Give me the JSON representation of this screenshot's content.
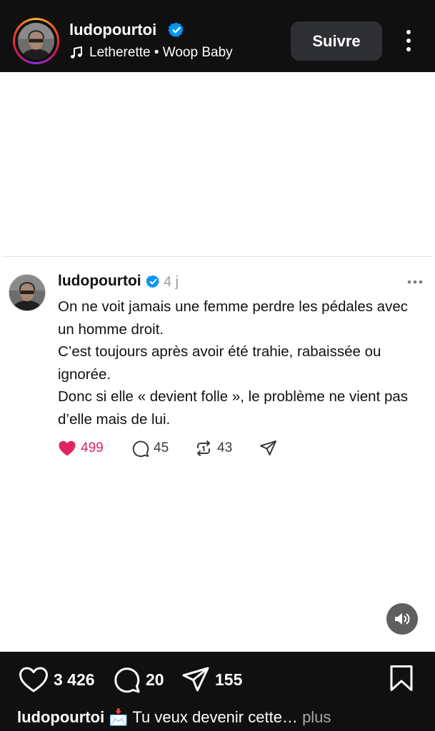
{
  "header": {
    "username": "ludopourtoi",
    "track": "Letherette • Woop Baby",
    "follow_label": "Suivre"
  },
  "post": {
    "username": "ludopourtoi",
    "time": "4 j",
    "paragraphs": [
      "On ne voit jamais une femme perdre les pédales avec un homme droit.",
      "C’est toujours après avoir été trahie, rabaissée ou ignorée.",
      "Donc si elle « devient folle », le problème ne vient pas d’elle mais de lui."
    ],
    "likes": "499",
    "comments": "45",
    "reposts": "43"
  },
  "footer": {
    "likes": "3 426",
    "comments": "20",
    "shares": "155",
    "caption_user": "ludopourtoi",
    "caption_text": "📩 Tu veux devenir cette…",
    "caption_more": "plus"
  },
  "colors": {
    "bar_background": "#101010",
    "like_red": "#e0245e",
    "verified_blue": "#0095f6"
  },
  "icons": [
    "verified-icon",
    "music-note-icon",
    "more-vertical-icon",
    "more-horizontal-icon",
    "heart-icon",
    "comment-icon",
    "repost-icon",
    "send-icon",
    "volume-icon",
    "bookmark-icon"
  ]
}
